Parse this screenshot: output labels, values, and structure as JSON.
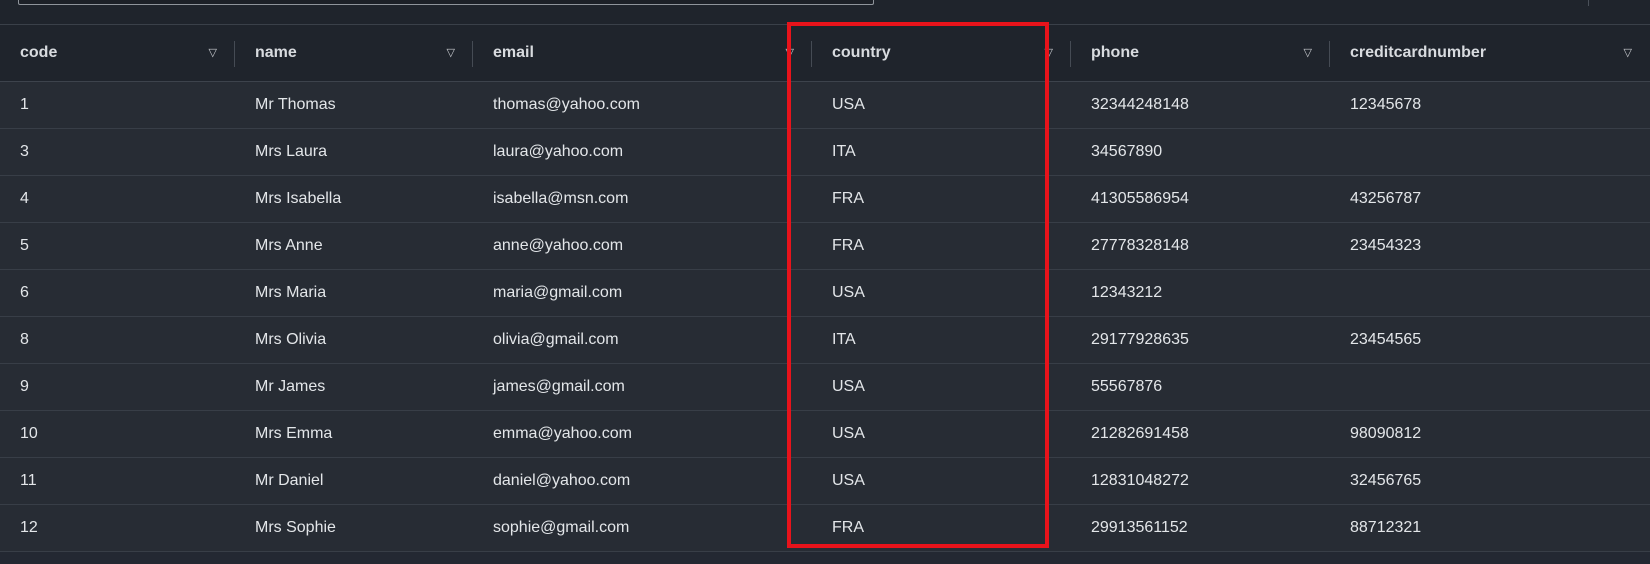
{
  "columns": [
    {
      "key": "code",
      "label": "code",
      "sort_icon": "filter-triangle-icon"
    },
    {
      "key": "name",
      "label": "name",
      "sort_icon": "filter-triangle-icon"
    },
    {
      "key": "email",
      "label": "email",
      "sort_icon": "filter-triangle-icon"
    },
    {
      "key": "country",
      "label": "country",
      "sort_icon": "filter-triangle-icon"
    },
    {
      "key": "phone",
      "label": "phone",
      "sort_icon": "filter-triangle-icon"
    },
    {
      "key": "creditcardnumber",
      "label": "creditcardnumber",
      "sort_icon": "filter-triangle-icon"
    }
  ],
  "sort_glyph": "▽",
  "rows": [
    {
      "code": "1",
      "name": "Mr Thomas",
      "email": "thomas@yahoo.com",
      "country": "USA",
      "phone": "32344248148",
      "creditcardnumber": "12345678"
    },
    {
      "code": "3",
      "name": "Mrs Laura",
      "email": "laura@yahoo.com",
      "country": "ITA",
      "phone": "34567890",
      "creditcardnumber": ""
    },
    {
      "code": "4",
      "name": "Mrs Isabella",
      "email": "isabella@msn.com",
      "country": "FRA",
      "phone": "41305586954",
      "creditcardnumber": "43256787"
    },
    {
      "code": "5",
      "name": "Mrs Anne",
      "email": "anne@yahoo.com",
      "country": "FRA",
      "phone": "27778328148",
      "creditcardnumber": "23454323"
    },
    {
      "code": "6",
      "name": "Mrs Maria",
      "email": "maria@gmail.com",
      "country": "USA",
      "phone": "12343212",
      "creditcardnumber": ""
    },
    {
      "code": "8",
      "name": "Mrs Olivia",
      "email": "olivia@gmail.com",
      "country": "ITA",
      "phone": "29177928635",
      "creditcardnumber": "23454565"
    },
    {
      "code": "9",
      "name": "Mr James",
      "email": "james@gmail.com",
      "country": "USA",
      "phone": "55567876",
      "creditcardnumber": ""
    },
    {
      "code": "10",
      "name": "Mrs Emma",
      "email": "emma@yahoo.com",
      "country": "USA",
      "phone": "21282691458",
      "creditcardnumber": "98090812"
    },
    {
      "code": "11",
      "name": "Mr Daniel",
      "email": "daniel@yahoo.com",
      "country": "USA",
      "phone": "12831048272",
      "creditcardnumber": "32456765"
    },
    {
      "code": "12",
      "name": "Mrs Sophie",
      "email": "sophie@gmail.com",
      "country": "FRA",
      "phone": "29913561152",
      "creditcardnumber": "88712321"
    }
  ],
  "highlight": {
    "column": "country",
    "color": "#e8131b"
  },
  "colors": {
    "background": "#232832",
    "header_bg": "#1f242c",
    "row_bg": "#272c34",
    "grid_line": "#383e47"
  }
}
